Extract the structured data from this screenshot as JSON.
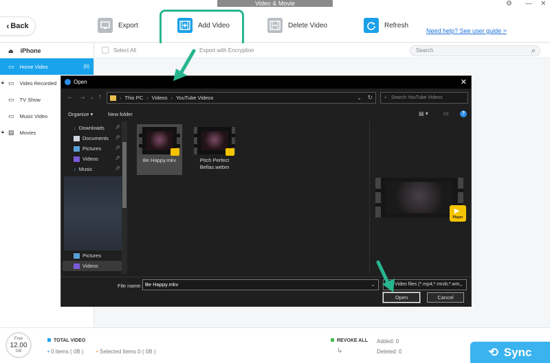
{
  "window": {
    "title": "Video & Movie"
  },
  "toolbar": {
    "back_label": "Back",
    "export_label": "Export",
    "add_video_label": "Add Video",
    "delete_video_label": "Delete Video",
    "refresh_label": "Refresh",
    "help_link": "Need help? See user guide >"
  },
  "sidebar": {
    "device": "iPhone",
    "items": [
      {
        "label": "Home Video",
        "count": "(0)"
      },
      {
        "label": "Video Recorded"
      },
      {
        "label": "TV Show"
      },
      {
        "label": "Music Video"
      },
      {
        "label": "Movies"
      }
    ]
  },
  "main": {
    "select_all": "Select All",
    "export_encryption": "Export with Encryption",
    "search_placeholder": "Search"
  },
  "bottom": {
    "free_label": "Free",
    "free_value": "12.00",
    "free_unit": "GB",
    "total_video_label": "TOTAL VIDEO",
    "items_text": "0 items ( 0B )",
    "selected_text": "Selected Items 0 ( 0B )",
    "revoke_all": "REVOKE ALL",
    "added": "Added: 0",
    "deleted": "Deleted: 0",
    "sync_label": "Sync"
  },
  "dialog": {
    "title": "Open",
    "breadcrumb": [
      "This PC",
      "Videos",
      "YouTube Videos"
    ],
    "search_placeholder": "Search YouTube Videos",
    "organize": "Organize",
    "new_folder": "New folder",
    "nav_items": [
      {
        "label": "Downloads"
      },
      {
        "label": "Documents"
      },
      {
        "label": "Pictures"
      },
      {
        "label": "Videos"
      },
      {
        "label": "Music"
      }
    ],
    "nav_items_lower": [
      {
        "label": "Pictures"
      },
      {
        "label": "Videos"
      }
    ],
    "files": [
      {
        "name": "Be Happy.mkv"
      },
      {
        "name": "Pitch Perfect Bellas.webm"
      }
    ],
    "preview_badge": "Player",
    "file_name_label": "File name:",
    "file_name_value": "Be Happy.mkv",
    "file_type_value": "Video files (*.mp4;*.rmvb;*.wm",
    "open_label": "Open",
    "cancel_label": "Cancel"
  },
  "colors": {
    "accent": "#19a3ec",
    "highlight": "#27b58f",
    "sync": "#3ab3ee"
  }
}
